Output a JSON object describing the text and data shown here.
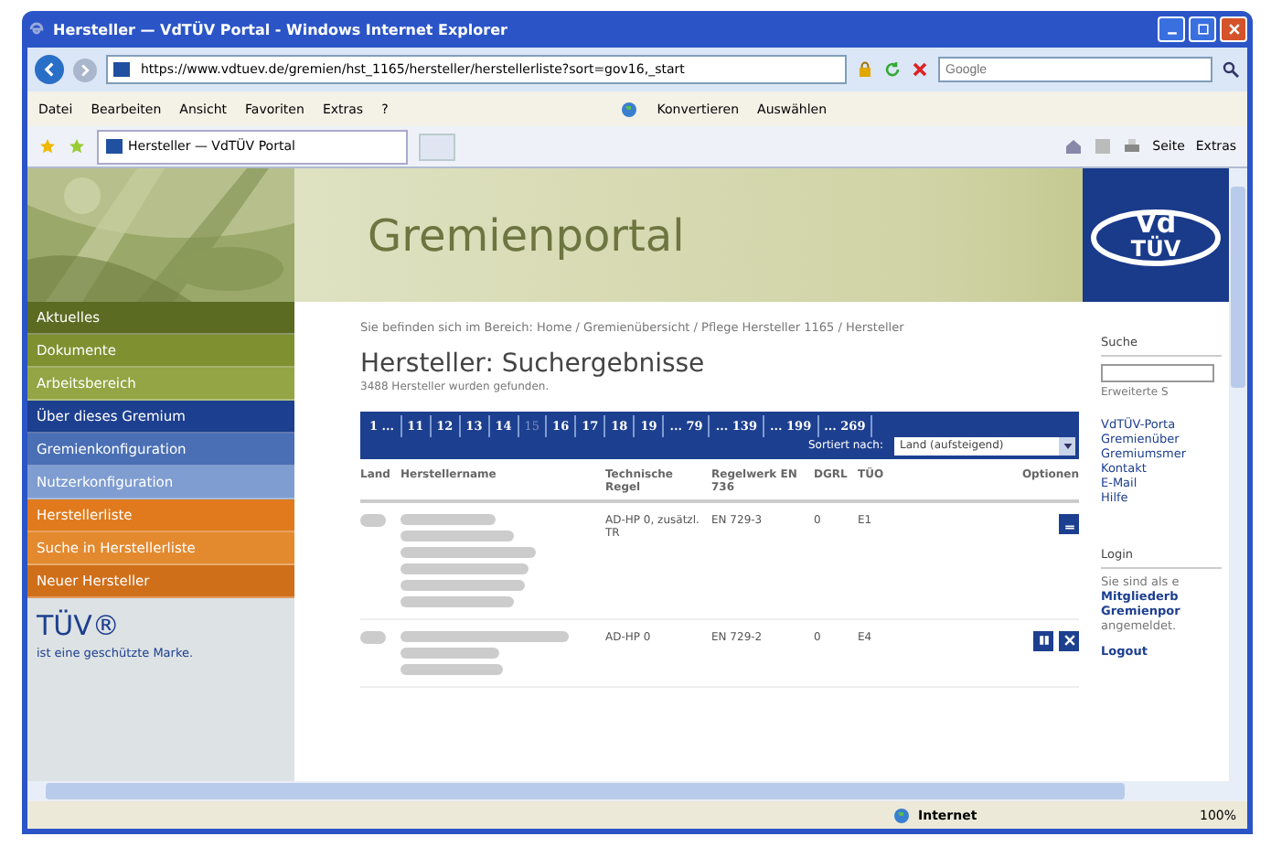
{
  "window": {
    "title": "Hersteller — VdTÜV Portal - Windows Internet Explorer"
  },
  "address_bar": {
    "url": "https://www.vdtuev.de/gremien/hst_1165/hersteller/herstellerliste?sort=gov16,_start",
    "search_placeholder": "Google"
  },
  "menu": [
    "Datei",
    "Bearbeiten",
    "Ansicht",
    "Favoriten",
    "Extras",
    "?"
  ],
  "toolbar": [
    "Konvertieren",
    "Auswählen"
  ],
  "tab": {
    "label": "Hersteller — VdTÜV Portal"
  },
  "command_bar": [
    "Seite",
    "Extras"
  ],
  "header": {
    "title": "Gremienportal",
    "logo_text": [
      "Vd",
      "TÜV"
    ]
  },
  "sidebar": {
    "items": [
      {
        "label": "Aktuelles",
        "color": "#5b6b22"
      },
      {
        "label": "Dokumente",
        "color": "#7e9030"
      },
      {
        "label": "Arbeitsbereich",
        "color": "#93a544"
      },
      {
        "label": "Über dieses Gremium",
        "color": "#1d3f8f"
      },
      {
        "label": "Gremienkonfiguration",
        "color": "#4a6fb5"
      },
      {
        "label": "Nutzerkonfiguration",
        "color": "#7f9dd0"
      },
      {
        "label": "Herstellerliste",
        "color": "#e07a1c"
      },
      {
        "label": "Suche in Herstellerliste",
        "color": "#e3892e"
      },
      {
        "label": "Neuer Hersteller",
        "color": "#d06f1a"
      }
    ],
    "brand": "TÜV®",
    "brand_note": "ist eine geschützte Marke."
  },
  "breadcrumb": "Sie befinden sich im Bereich: Home / Gremienübersicht / Pflege Hersteller 1165 / Hersteller",
  "heading": "Hersteller: Suchergebnisse",
  "result_count": "3488 Hersteller wurden gefunden.",
  "pagination": [
    {
      "label": "1 ...",
      "selected": false
    },
    {
      "label": "11",
      "selected": false
    },
    {
      "label": "12",
      "selected": false
    },
    {
      "label": "13",
      "selected": false
    },
    {
      "label": "14",
      "selected": false
    },
    {
      "label": "15",
      "selected": true
    },
    {
      "label": "16",
      "selected": false
    },
    {
      "label": "17",
      "selected": false
    },
    {
      "label": "18",
      "selected": false
    },
    {
      "label": "19",
      "selected": false
    },
    {
      "label": "... 79",
      "selected": false
    },
    {
      "label": "... 139",
      "selected": false
    },
    {
      "label": "... 199",
      "selected": false
    },
    {
      "label": "... 269",
      "selected": false
    }
  ],
  "sort": {
    "label": "Sortiert nach:",
    "value": "Land (aufsteigend)"
  },
  "table": {
    "columns": [
      "Land",
      "Herstellername",
      "Technische Regel",
      "Regelwerk EN 736",
      "DGRL",
      "TÜO",
      "Optionen"
    ],
    "rows": [
      {
        "rule": "AD-HP 0, zusätzl. TR",
        "standard": "EN 729-3",
        "dgrl": "0",
        "tuo": "E1",
        "actions": [
          {
            "kind": "edit"
          }
        ]
      },
      {
        "rule": "AD-HP 0",
        "standard": "EN 729-2",
        "dgrl": "0",
        "tuo": "E4",
        "actions": [
          {
            "kind": "copy"
          },
          {
            "kind": "delete"
          }
        ]
      }
    ]
  },
  "right": {
    "search_title": "Suche",
    "advanced_link": "Erweiterte S",
    "links": [
      "VdTÜV-Porta",
      "Gremienüber",
      "Gremiumsmer",
      "Kontakt",
      "E-Mail",
      "Hilfe"
    ],
    "login_title": "Login",
    "login_lines": [
      {
        "text": "Sie sind als e",
        "bold": false
      },
      {
        "text": "Mitgliederb",
        "bold": true
      },
      {
        "text": "Gremienpor",
        "bold": true
      },
      {
        "text": "angemeldet.",
        "bold": false
      }
    ],
    "logout": "Logout"
  },
  "status_bar": {
    "zone": "Internet",
    "zoom": "100%"
  }
}
